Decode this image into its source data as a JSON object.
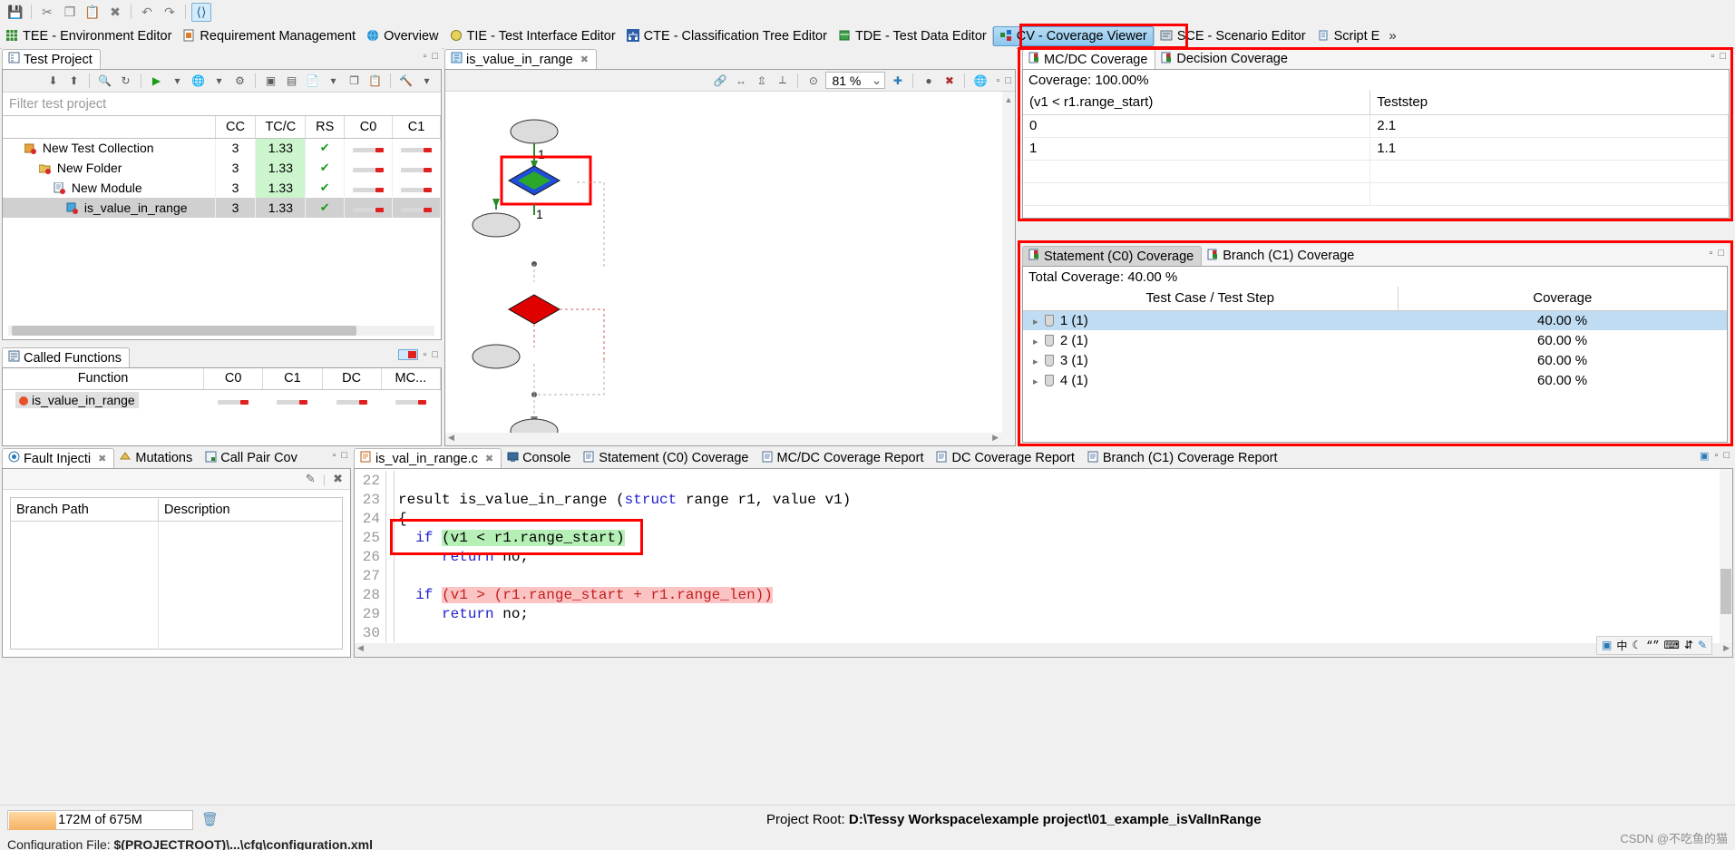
{
  "toolbar": {
    "buttons": [
      {
        "name": "save-icon",
        "glyph": "ὋE"
      },
      {
        "name": "cut-icon",
        "glyph": "✂"
      },
      {
        "name": "copy-icon",
        "glyph": "❐"
      },
      {
        "name": "paste-icon",
        "glyph": "ὌB"
      },
      {
        "name": "delete-icon",
        "glyph": "✖"
      },
      {
        "name": "undo-icon",
        "glyph": "↶"
      },
      {
        "name": "redo-icon",
        "glyph": "↷"
      },
      {
        "name": "source-code-icon",
        "glyph": "‹›"
      }
    ]
  },
  "perspective_bar": {
    "items": [
      {
        "label": "TEE - Environment Editor",
        "icon": "grid-icon",
        "selected": false
      },
      {
        "label": "Requirement Management",
        "icon": "document-icon",
        "selected": false
      },
      {
        "label": "Overview",
        "icon": "globe-icon",
        "selected": false
      },
      {
        "label": "TIE - Test Interface Editor",
        "icon": "interface-icon",
        "selected": false
      },
      {
        "label": "CTE - Classification Tree Editor",
        "icon": "tree-icon",
        "selected": false
      },
      {
        "label": "TDE - Test Data Editor",
        "icon": "data-icon",
        "selected": false
      },
      {
        "label": "CV - Coverage Viewer",
        "icon": "coverage-icon",
        "selected": true
      },
      {
        "label": "SCE - Scenario Editor",
        "icon": "scenario-icon",
        "selected": false
      },
      {
        "label": "Script E",
        "icon": "script-icon",
        "selected": false
      }
    ],
    "overflow": "»"
  },
  "test_project": {
    "tab_label": "Test Project",
    "filter_placeholder": "Filter test project",
    "columns": [
      "",
      "CC",
      "TC/C",
      "RS",
      "C0",
      "C1"
    ],
    "rows": [
      {
        "name": "New Test Collection",
        "indent": 0,
        "icon": "collection-icon",
        "cc": "3",
        "tcc": "1.33",
        "tcc_hl": true,
        "rs": "✔",
        "c0": "bar",
        "c1": "bar",
        "selected": false
      },
      {
        "name": "New Folder",
        "indent": 1,
        "icon": "folder-icon",
        "cc": "3",
        "tcc": "1.33",
        "tcc_hl": true,
        "rs": "✔",
        "c0": "bar",
        "c1": "bar",
        "selected": false
      },
      {
        "name": "New Module",
        "indent": 2,
        "icon": "module-icon",
        "cc": "3",
        "tcc": "1.33",
        "tcc_hl": true,
        "rs": "✔",
        "c0": "bar",
        "c1": "bar",
        "selected": false
      },
      {
        "name": "is_value_in_range",
        "indent": 3,
        "icon": "function-icon",
        "cc": "3",
        "tcc": "1.33",
        "tcc_hl": false,
        "rs": "✔",
        "c0": "bar",
        "c1": "bar",
        "selected": true
      }
    ]
  },
  "called_functions": {
    "tab_label": "Called Functions",
    "columns": [
      "Function",
      "C0",
      "C1",
      "DC",
      "MC..."
    ],
    "rows": [
      {
        "name": "is_value_in_range",
        "c0": "bar",
        "c1": "bar",
        "dc": "bar",
        "mc": "bar"
      }
    ]
  },
  "fault_injection": {
    "tabs": [
      {
        "label": "Fault Injecti",
        "icon": "fault-icon",
        "selected": true,
        "closable": true
      },
      {
        "label": "Mutations",
        "icon": "mutation-icon",
        "selected": false,
        "closable": false
      },
      {
        "label": "Call Pair Cov",
        "icon": "callpair-icon",
        "selected": false,
        "closable": false
      }
    ],
    "columns": [
      "Branch Path",
      "Description"
    ],
    "rows": []
  },
  "diagram": {
    "tab_label": "is_value_in_range",
    "zoom": "81 %",
    "edge_labels": [
      "1",
      "1"
    ]
  },
  "mcdc_panel": {
    "tabs": [
      {
        "label": "MC/DC Coverage",
        "icon": "mcdc-icon",
        "selected": true
      },
      {
        "label": "Decision Coverage",
        "icon": "decision-icon",
        "selected": false
      }
    ],
    "coverage_label": "Coverage: 100.00%",
    "columns": [
      "(v1 < r1.range_start)",
      "Teststep"
    ],
    "rows": [
      {
        "condition": "0",
        "teststep": "2.1"
      },
      {
        "condition": "1",
        "teststep": "1.1"
      },
      {
        "condition": "",
        "teststep": ""
      },
      {
        "condition": "",
        "teststep": ""
      }
    ]
  },
  "statement_panel": {
    "tabs": [
      {
        "label": "Statement (C0) Coverage",
        "icon": "stmt-icon",
        "selected": true
      },
      {
        "label": "Branch (C1) Coverage",
        "icon": "branch-icon",
        "selected": false
      }
    ],
    "total_label": "Total Coverage: 40.00 %",
    "columns": [
      "Test Case / Test Step",
      "Coverage"
    ],
    "rows": [
      {
        "name": "1 (1)",
        "coverage": "40.00 %",
        "selected": true
      },
      {
        "name": "2 (1)",
        "coverage": "60.00 %",
        "selected": false
      },
      {
        "name": "3 (1)",
        "coverage": "60.00 %",
        "selected": false
      },
      {
        "name": "4 (1)",
        "coverage": "60.00 %",
        "selected": false
      }
    ]
  },
  "code_editor": {
    "tabs": [
      {
        "label": "is_val_in_range.c",
        "icon": "c-file-icon",
        "selected": true,
        "closable": true
      },
      {
        "label": "Console",
        "icon": "console-icon",
        "selected": false,
        "closable": false
      },
      {
        "label": "Statement (C0) Coverage",
        "icon": "stmt-icon",
        "selected": false,
        "closable": false
      },
      {
        "label": "MC/DC Coverage Report",
        "icon": "report-icon",
        "selected": false,
        "closable": false
      },
      {
        "label": "DC Coverage Report",
        "icon": "report-icon",
        "selected": false,
        "closable": false
      },
      {
        "label": "Branch (C1) Coverage Report",
        "icon": "report-icon",
        "selected": false,
        "closable": false
      }
    ],
    "lines": [
      {
        "no": "22",
        "segments": [
          {
            "t": "",
            "s": "plain"
          }
        ]
      },
      {
        "no": "23",
        "segments": [
          {
            "t": "result is_value_in_range (",
            "s": "plain"
          },
          {
            "t": "struct",
            "s": "kw"
          },
          {
            "t": " range r1, value v1)",
            "s": "plain"
          }
        ]
      },
      {
        "no": "24",
        "segments": [
          {
            "t": "{",
            "s": "plain"
          }
        ]
      },
      {
        "no": "25",
        "segments": [
          {
            "t": "  ",
            "s": "plain"
          },
          {
            "t": "if",
            "s": "kw"
          },
          {
            "t": " ",
            "s": "plain"
          },
          {
            "t": "(v1 < r1.range_start)",
            "s": "hl-g"
          }
        ]
      },
      {
        "no": "26",
        "segments": [
          {
            "t": "     ",
            "s": "plain"
          },
          {
            "t": "return",
            "s": "kw"
          },
          {
            "t": " no;",
            "s": "plain"
          }
        ]
      },
      {
        "no": "27",
        "segments": [
          {
            "t": "",
            "s": "plain"
          }
        ]
      },
      {
        "no": "28",
        "segments": [
          {
            "t": "  ",
            "s": "plain"
          },
          {
            "t": "if",
            "s": "kw"
          },
          {
            "t": " ",
            "s": "plain"
          },
          {
            "t": "(v1 > (r1.range_start + r1.range_len))",
            "s": "hl-r"
          }
        ]
      },
      {
        "no": "29",
        "segments": [
          {
            "t": "     ",
            "s": "plain"
          },
          {
            "t": "return",
            "s": "kw"
          },
          {
            "t": " no;",
            "s": "plain"
          }
        ]
      },
      {
        "no": "30",
        "segments": [
          {
            "t": "",
            "s": "plain"
          }
        ]
      }
    ],
    "ime": [
      "中",
      "☾",
      "“”",
      "⌨",
      "⇵",
      "✎"
    ]
  },
  "status_bar": {
    "heap": "172M of 675M",
    "project_root_label": "Project Root:",
    "project_root_value": "D:\\Tessy Workspace\\example project\\01_example_isValInRange",
    "config_label": "Configuration File:",
    "config_value": "$(PROJECTROOT)\\...\\cfg\\configuration.xml",
    "watermark": "CSDN @不吃鱼的猫"
  },
  "colors": {
    "accent": "#ff0000",
    "selection": "#bfdcf2",
    "green_hl": "#cdf5cd",
    "red_hl": "#fcc3c3"
  }
}
